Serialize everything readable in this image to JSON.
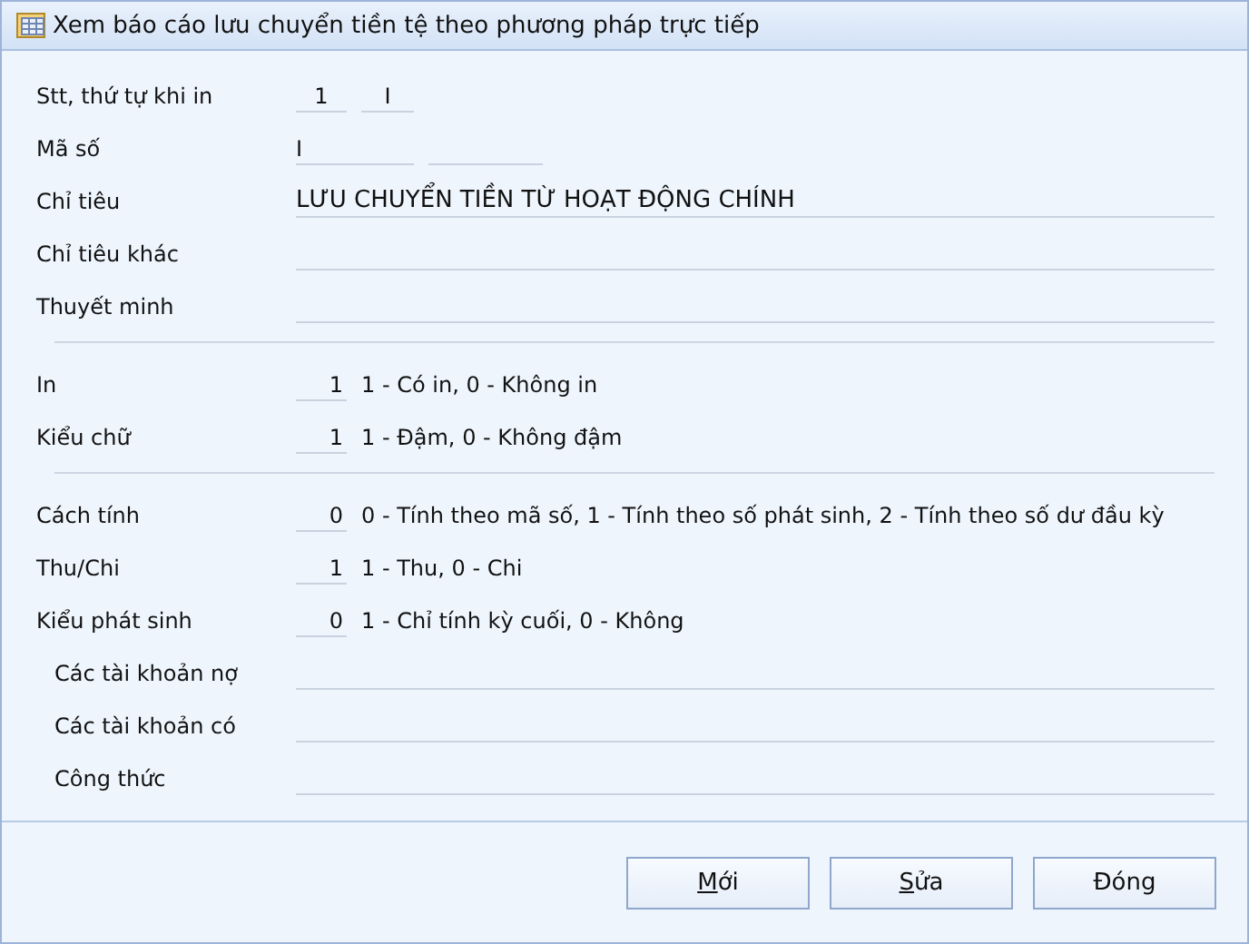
{
  "window": {
    "title": "Xem báo cáo lưu chuyển tiền tệ theo phương pháp trực tiếp"
  },
  "sections": [
    {
      "rows": [
        {
          "kind": "pair",
          "label": "Stt, thứ tự khi in",
          "values": [
            "1",
            "I"
          ]
        },
        {
          "kind": "code",
          "label": "Mã số",
          "values": [
            "I"
          ]
        },
        {
          "kind": "text",
          "label": "Chỉ tiêu",
          "value": "LƯU CHUYỂN TIỀN TỪ HOẠT ĐỘNG CHÍNH"
        },
        {
          "kind": "text",
          "label": "Chỉ tiêu khác"
        },
        {
          "kind": "text",
          "label": "Thuyết minh"
        }
      ]
    },
    {
      "rows": [
        {
          "kind": "option",
          "label": "In",
          "value": "1",
          "hint": "1 - Có in, 0 - Không in"
        },
        {
          "kind": "option",
          "label": "Kiểu chữ",
          "value": "1",
          "hint": "1 - Đậm, 0 - Không đậm"
        }
      ]
    },
    {
      "rows": [
        {
          "kind": "option",
          "label": "Cách tính",
          "value": "0",
          "hint": "0 - Tính theo mã số, 1 - Tính theo số phát sinh, 2 - Tính theo số dư đầu kỳ"
        },
        {
          "kind": "option",
          "label": "Thu/Chi",
          "value": "1",
          "hint": "1 - Thu, 0 - Chi"
        },
        {
          "kind": "option",
          "label": "Kiểu phát sinh",
          "value": "0",
          "hint": "1 - Chỉ tính kỳ cuối, 0 - Không"
        },
        {
          "kind": "text",
          "label": "Các tài khoản nợ",
          "indented": true
        },
        {
          "kind": "text",
          "label": "Các tài khoản có",
          "indented": true
        },
        {
          "kind": "text",
          "label": "Công thức",
          "indented": true
        }
      ]
    }
  ],
  "buttons": [
    {
      "label": "Mới",
      "underline_first": true
    },
    {
      "label": "Sửa",
      "underline_first": true
    },
    {
      "label": "Đóng",
      "underline_first": false
    }
  ]
}
